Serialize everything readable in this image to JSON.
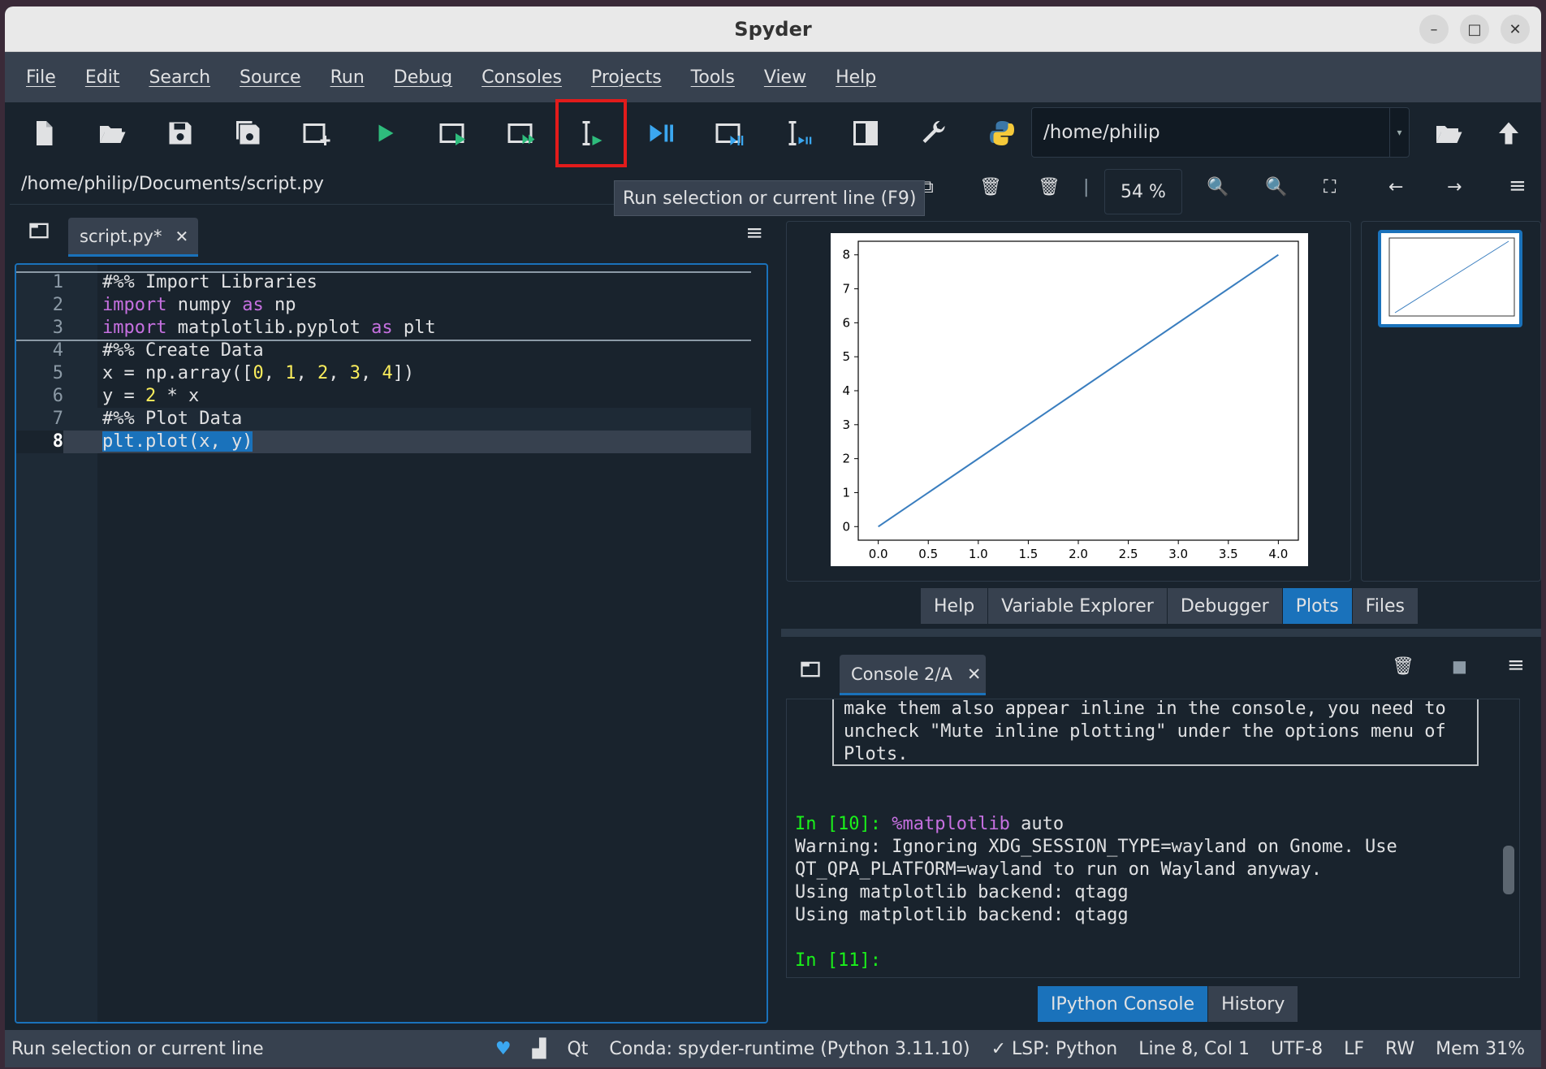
{
  "window": {
    "title": "Spyder"
  },
  "menu": [
    "File",
    "Edit",
    "Search",
    "Source",
    "Run",
    "Debug",
    "Consoles",
    "Projects",
    "Tools",
    "View",
    "Help"
  ],
  "toolbar": {
    "path": "/home/philip",
    "tooltip": "Run selection or current line (F9)"
  },
  "editor": {
    "file_path": "/home/philip/Documents/script.py",
    "tab_label": "script.py*",
    "current_line": 8
  },
  "plots": {
    "zoom": "54 %",
    "pane_tabs": [
      "Help",
      "Variable Explorer",
      "Debugger",
      "Plots",
      "Files"
    ],
    "active_tab": "Plots"
  },
  "chart_data": {
    "type": "line",
    "x": [
      0,
      1,
      2,
      3,
      4
    ],
    "y": [
      0,
      2,
      4,
      6,
      8
    ],
    "xticks": [
      "0.0",
      "0.5",
      "1.0",
      "1.5",
      "2.0",
      "2.5",
      "3.0",
      "3.5",
      "4.0"
    ],
    "yticks": [
      "0",
      "1",
      "2",
      "3",
      "4",
      "5",
      "6",
      "7",
      "8"
    ],
    "xlim": [
      -0.2,
      4.2
    ],
    "ylim": [
      -0.4,
      8.4
    ],
    "color": "#3a7ebf"
  },
  "console": {
    "tab_label": "Console 2/A",
    "note_lines": [
      "make them also appear inline in the console, you need to",
      "uncheck \"Mute inline plotting\" under the options menu of",
      "Plots."
    ],
    "prompt_10": "In [10]: ",
    "cmd_magic": "%matplotlib",
    "cmd_arg": " auto",
    "out1": "Warning: Ignoring XDG_SESSION_TYPE=wayland on Gnome. Use",
    "out2": "QT_QPA_PLATFORM=wayland to run on Wayland anyway.",
    "out3": "Using matplotlib backend: qtagg",
    "out4": "Using matplotlib backend: qtagg",
    "prompt_11": "In [11]:",
    "pane_tabs": [
      "IPython Console",
      "History"
    ],
    "active_tab": "IPython Console"
  },
  "status": {
    "message": "Run selection or current line",
    "qt": "Qt",
    "conda": "Conda: spyder-runtime (Python 3.11.10)",
    "lsp": "LSP: Python",
    "position": "Line 8, Col 1",
    "encoding": "UTF-8",
    "eol": "LF",
    "rw": "RW",
    "mem": "Mem 31%"
  },
  "colors": {
    "accent": "#1a72bb",
    "highlight_box": "#e21b1b",
    "run_green": "#2ebc7c"
  }
}
